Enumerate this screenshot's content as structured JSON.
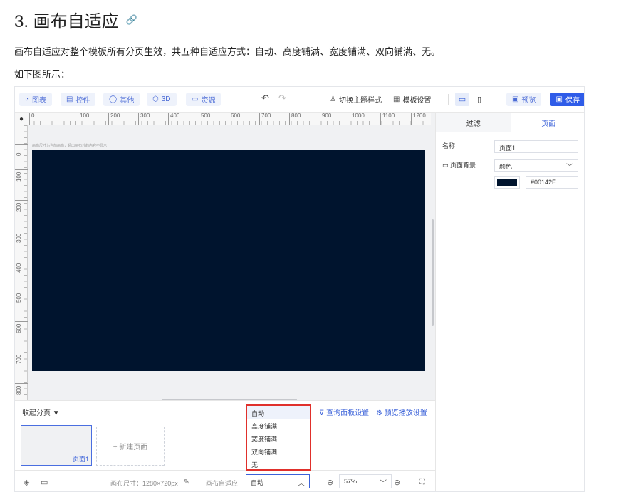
{
  "doc": {
    "title": "3. 画布自适应",
    "intro": "画布自适应对整个模板所有分页生效，共五种自适应方式：自动、高度铺满、宽度铺满、双向铺满、无。",
    "figure_caption": "如下图所示："
  },
  "toolbar": {
    "chart_label": "图表",
    "widget_label": "控件",
    "other_label": "其他",
    "threed_label": "3D",
    "resource_label": "资源",
    "theme_label": "切换主题样式",
    "template_settings_label": "模板设置",
    "preview_label": "预览",
    "save_label": "保存"
  },
  "ruler": {
    "h_ticks": [
      "0",
      "100",
      "200",
      "300",
      "400",
      "500",
      "600",
      "700",
      "800",
      "900",
      "1000",
      "1100",
      "1200"
    ],
    "v_ticks": [
      "0",
      "100",
      "200",
      "300",
      "400",
      "500",
      "600",
      "700",
      "800"
    ]
  },
  "canvas": {
    "hint": "画布尺寸为当前画布，超出画布外的内容不显示",
    "background": "#00142E"
  },
  "pages": {
    "collapse_label": "收起分页 ▼",
    "query_panel_label": "查询面板设置",
    "preview_play_label": "预览播放设置",
    "items": [
      {
        "label": "页面1"
      }
    ],
    "new_page_label": "+ 新建页面"
  },
  "bottom_bar": {
    "canvas_size": "画布尺寸：1280×720px",
    "fit_label": "画布自适应",
    "fit_value": "自动",
    "zoom_value": "57%"
  },
  "fit_dropdown": {
    "options": [
      "自动",
      "高度铺满",
      "宽度铺满",
      "双向铺满",
      "无"
    ],
    "selected": "自动"
  },
  "right_panel": {
    "tab_filter": "过滤",
    "tab_page": "页面",
    "name_label": "名称",
    "name_value": "页面1",
    "bg_label": "页面背景",
    "bg_type": "颜色",
    "bg_color": "#00142E"
  }
}
